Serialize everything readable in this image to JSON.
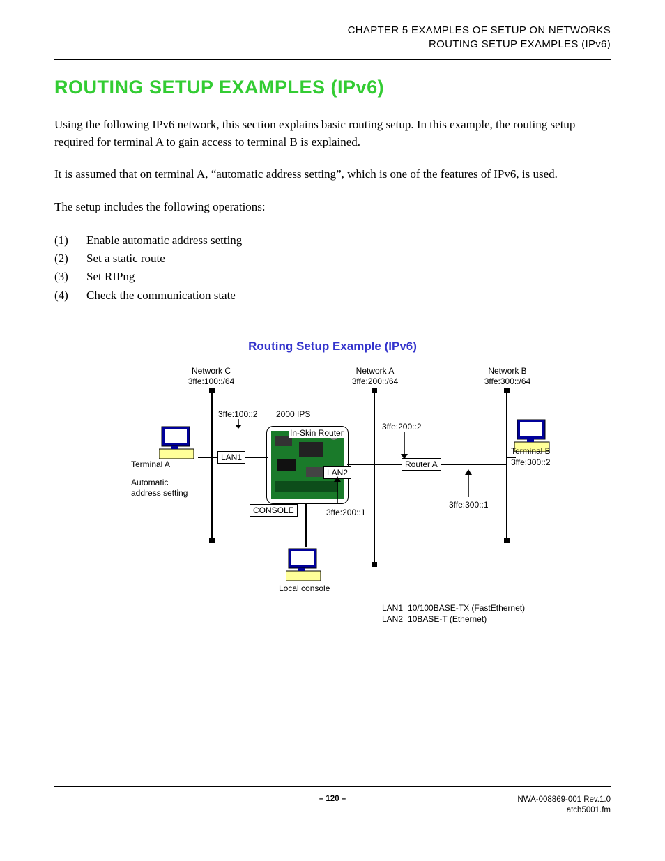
{
  "header": {
    "chapter_line": "CHAPTER 5   EXAMPLES OF SETUP ON NETWORKS",
    "section_line": "ROUTING SETUP EXAMPLES (IPv6)"
  },
  "title": "ROUTING SETUP EXAMPLES (IPv6)",
  "paragraphs": {
    "p1": "Using the following IPv6 network, this section explains basic routing setup. In this example, the routing setup required for terminal A to gain access to terminal B is explained.",
    "p2": "It is assumed that on terminal A, “automatic address setting”, which is one of the features of IPv6, is used.",
    "ops_intro": "The setup includes the following operations:"
  },
  "ops": [
    {
      "n": "(1)",
      "t": "Enable automatic address setting"
    },
    {
      "n": "(2)",
      "t": "Set a static route"
    },
    {
      "n": "(3)",
      "t": "Set RIPng"
    },
    {
      "n": "(4)",
      "t": "Check the communication state"
    }
  ],
  "figure": {
    "title": "Routing Setup Example (IPv6)",
    "networks": {
      "c": {
        "name": "Network C",
        "net": "3ffe:100::/64"
      },
      "a": {
        "name": "Network A",
        "net": "3ffe:200::/64"
      },
      "b": {
        "name": "Network B",
        "net": "3ffe:300::/64"
      }
    },
    "labels": {
      "router_addr_lan1": "3ffe:100::2",
      "system": "2000 IPS",
      "in_skin": "In-Skin Router",
      "router_addr_lan2_top": "3ffe:200::2",
      "lan1": "LAN1",
      "lan2": "LAN2",
      "router_a": "Router A",
      "terminal_a": "Terminal A",
      "terminal_b": "Terminal B",
      "terminal_b_addr": "3ffe:300::2",
      "auto1": "Automatic",
      "auto2": "address setting",
      "console": "CONSOLE",
      "addr_lan2_bottom": "3ffe:200::1",
      "router_a_addr_b": "3ffe:300::1",
      "local_console": "Local console",
      "legend1": "LAN1=10/100BASE-TX (FastEthernet)",
      "legend2": "LAN2=10BASE-T (Ethernet)"
    }
  },
  "footer": {
    "page": "– 120 –",
    "doc1": "NWA-008869-001 Rev.1.0",
    "doc2": "atch5001.fm"
  }
}
